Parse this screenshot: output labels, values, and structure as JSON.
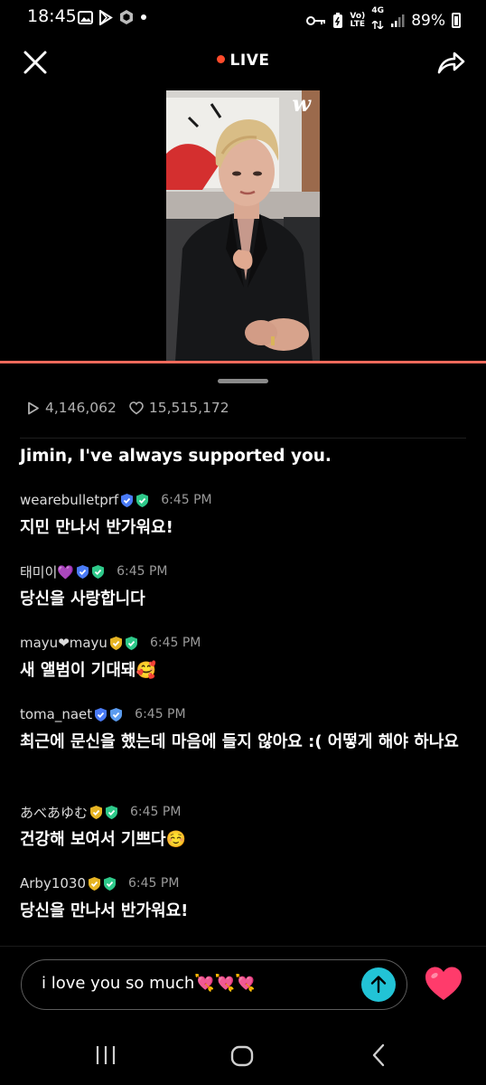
{
  "status_bar": {
    "time": "18:45",
    "left_icons": [
      "gallery-icon",
      "play-store-icon",
      "app-icon",
      "dot-icon"
    ],
    "network_top": "Vo)",
    "network_bottom": "LTE",
    "signal_top": "4G",
    "battery": "89%"
  },
  "topbar": {
    "live_label": "LIVE",
    "live_dot_color": "#ff4b2b"
  },
  "video": {
    "watermark": "w"
  },
  "stats": {
    "views": "4,146,062",
    "likes": "15,515,172"
  },
  "pinned_message": "Jimin, I've always supported you.",
  "comments": [
    {
      "user": "wearebulletprf",
      "badges": [
        "blue",
        "green"
      ],
      "time": "6:45 PM",
      "message": "지민 만나서 반가워요!"
    },
    {
      "user": "태미이💜",
      "badges": [
        "blue",
        "green"
      ],
      "time": "6:45 PM",
      "message": "당신을 사랑합니다"
    },
    {
      "user": "mayu❤mayu",
      "badges": [
        "yellow",
        "green"
      ],
      "time": "6:45 PM",
      "message": "새 앨범이 기대돼🥰"
    },
    {
      "user": "toma_naet",
      "badges": [
        "blue",
        "blue"
      ],
      "time": "6:45 PM",
      "message": "최근에 문신을 했는데 마음에 들지 않아요 :( 어떻게 해야 하나요"
    },
    {
      "user": "あべあゆむ",
      "badges": [
        "yellow",
        "green"
      ],
      "time": "6:45 PM",
      "message": "건강해 보여서 기쁘다☺️"
    },
    {
      "user": "Arby1030",
      "badges": [
        "yellow",
        "green"
      ],
      "time": "6:45 PM",
      "message": "당신을 만나서 반가워요!"
    }
  ],
  "input": {
    "value": "i love you so much💘💘💘"
  },
  "colors": {
    "accent_cyan": "#22c3d6",
    "heart": "#ff3b6b",
    "progress": "#f26a5b",
    "badge_blue": "#4a7bf7",
    "badge_green": "#2ec98a",
    "badge_yellow": "#e6b423"
  }
}
